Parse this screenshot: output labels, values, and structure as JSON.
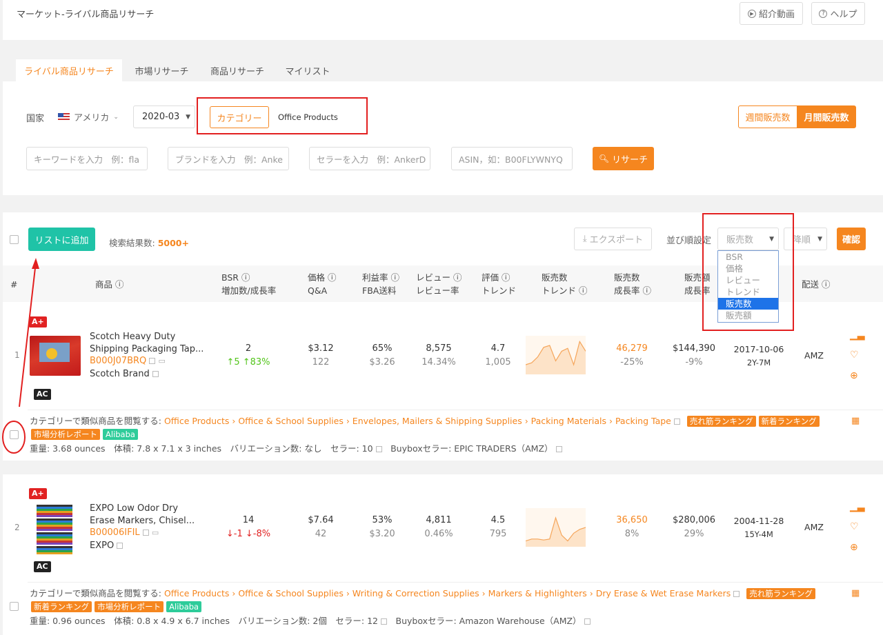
{
  "header": {
    "title": "マーケット-ライバル商品リサーチ",
    "video_btn": "紹介動画",
    "help_btn": "ヘルプ"
  },
  "tabs": [
    "ライバル商品リサーチ",
    "市場リサーチ",
    "商品リサーチ",
    "マイリスト"
  ],
  "filters": {
    "country_label": "国家",
    "country_value": "アメリカ",
    "month": "2020-03",
    "category_btn": "カテゴリー",
    "category_value": "Office Products",
    "weekly_btn": "週間販売数",
    "monthly_btn": "月間販売数",
    "keyword_ph": "キーワードを入力　例：fla",
    "brand_ph": "ブランドを入力　例：Anke",
    "seller_ph": "セラーを入力　例：AnkerD",
    "asin_ph": "ASIN，如：B00FLYWNYQ",
    "search_btn": "リサーチ"
  },
  "toolbar": {
    "add_list": "リストに追加",
    "result_label": "検索結果数:",
    "result_count": "5000+",
    "export": "エクスポート",
    "sort_label": "並び順設定",
    "sort_value": "販売数",
    "order_value": "降順",
    "confirm": "確認",
    "sort_options": [
      "BSR",
      "価格",
      "レビュー",
      "トレンド",
      "販売数",
      "販売額"
    ],
    "selected_option": "販売数"
  },
  "columns": {
    "num": "#",
    "product": "商品",
    "bsr": [
      "BSR",
      "増加数/成長率"
    ],
    "price": [
      "価格",
      "Q&A"
    ],
    "profit": [
      "利益率",
      "FBA送料"
    ],
    "review": [
      "レビュー",
      "レビュー率"
    ],
    "rating": [
      "評価",
      "トレンド"
    ],
    "trend": [
      "販売数",
      "トレンド"
    ],
    "sales": [
      "販売数",
      "成長率"
    ],
    "revenue": [
      "販売額",
      "成長率"
    ],
    "ship": "配送"
  },
  "rows": [
    {
      "index": "1",
      "badge_top": "A+",
      "badge_bottom": "AC",
      "title1": "Scotch Heavy Duty",
      "title2": "Shipping Packaging Tap...",
      "asin": "B000J07BRQ",
      "brand": "Scotch Brand",
      "bsr": "2",
      "bsr_inc": "↑5",
      "bsr_rate": "↑83%",
      "price": "$3.12",
      "qa": "122",
      "profit": "65%",
      "fba": "$3.26",
      "reviews": "8,575",
      "review_rate": "14.34%",
      "rating": "4.7",
      "rating_count": "1,005",
      "sales": "46,279",
      "sales_growth": "-25%",
      "revenue": "$144,390",
      "revenue_growth": "-9%",
      "date": "2017-10-06",
      "age": "2Y-7M",
      "ship": "AMZ",
      "trend": [
        10,
        12,
        18,
        28,
        30,
        14,
        24,
        27,
        10,
        34,
        24
      ],
      "cat_label": "カテゴリーで類似商品を閲覧する:",
      "cat_path": "Office Products › Office & School Supplies › Envelopes, Mailers & Shipping Supplies › Packing Materials › Packing Tape",
      "tag1": "売れ筋ランキング",
      "tag2": "新着ランキング",
      "tag3": "市場分析レポート",
      "tag4": "Alibaba",
      "weight": "重量: 3.68 ounces",
      "size": "体積: 7.8 x 7.1 x 3 inches",
      "variation": "バリエーション数: なし",
      "sellers": "セラー: 10",
      "buybox": "Buyboxセラー:  EPIC TRADERS（AMZ）"
    },
    {
      "index": "2",
      "badge_top": "A+",
      "badge_bottom": "AC",
      "title1": "EXPO Low Odor Dry",
      "title2": "Erase Markers, Chisel...",
      "asin": "B00006IFIL",
      "brand": "EXPO",
      "bsr": "14",
      "bsr_inc": "↓-1",
      "bsr_rate": "↓-8%",
      "price": "$7.64",
      "qa": "42",
      "profit": "53%",
      "fba": "$3.20",
      "reviews": "4,811",
      "review_rate": "0.46%",
      "rating": "4.5",
      "rating_count": "795",
      "sales": "36,650",
      "sales_growth": "8%",
      "revenue": "$280,006",
      "revenue_growth": "29%",
      "date": "2004-11-28",
      "age": "15Y-4M",
      "ship": "AMZ",
      "trend": [
        6,
        8,
        8,
        7,
        8,
        30,
        12,
        6,
        14,
        18,
        20
      ],
      "cat_label": "カテゴリーで類似商品を閲覧する:",
      "cat_path": "Office Products › Office & School Supplies › Writing & Correction Supplies › Markers & Highlighters › Dry Erase & Wet Erase Markers",
      "tag1": "売れ筋ランキング",
      "tag2": "新着ランキング",
      "tag3": "市場分析レポート",
      "tag4": "Alibaba",
      "weight": "重量: 0.96 ounces",
      "size": "体積: 0.8 x 4.9 x 6.7 inches",
      "variation": "バリエーション数: 2個",
      "sellers": "セラー: 12",
      "buybox": "Buyboxセラー:  Amazon Warehouse（AMZ）"
    }
  ],
  "colors": {
    "accent": "#f5861f",
    "teal": "#1fc3a7",
    "annotation_red": "#e21f1f"
  }
}
